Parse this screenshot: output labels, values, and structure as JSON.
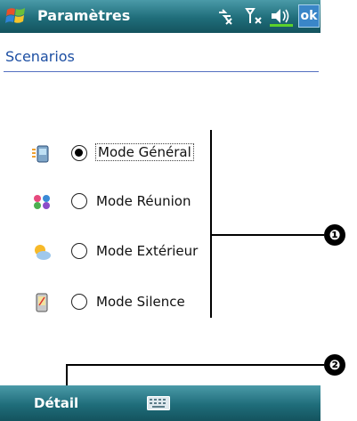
{
  "titlebar": {
    "title": "Paramètres",
    "ok_label": "ok"
  },
  "header": {
    "title": "Scenarios"
  },
  "scenarios": [
    {
      "label": "Mode Général",
      "selected": true,
      "icon": "general-mode-icon"
    },
    {
      "label": "Mode Réunion",
      "selected": false,
      "icon": "meeting-mode-icon"
    },
    {
      "label": "Mode Extérieur",
      "selected": false,
      "icon": "outdoor-mode-icon"
    },
    {
      "label": "Mode Silence",
      "selected": false,
      "icon": "silent-mode-icon"
    }
  ],
  "menubar": {
    "left_label": "Détail"
  },
  "callouts": {
    "first": "❶",
    "second": "❷"
  },
  "colors": {
    "bar": "#1f6d7a",
    "header_text": "#1d4fa3",
    "ok_button": "#3a86c8"
  }
}
